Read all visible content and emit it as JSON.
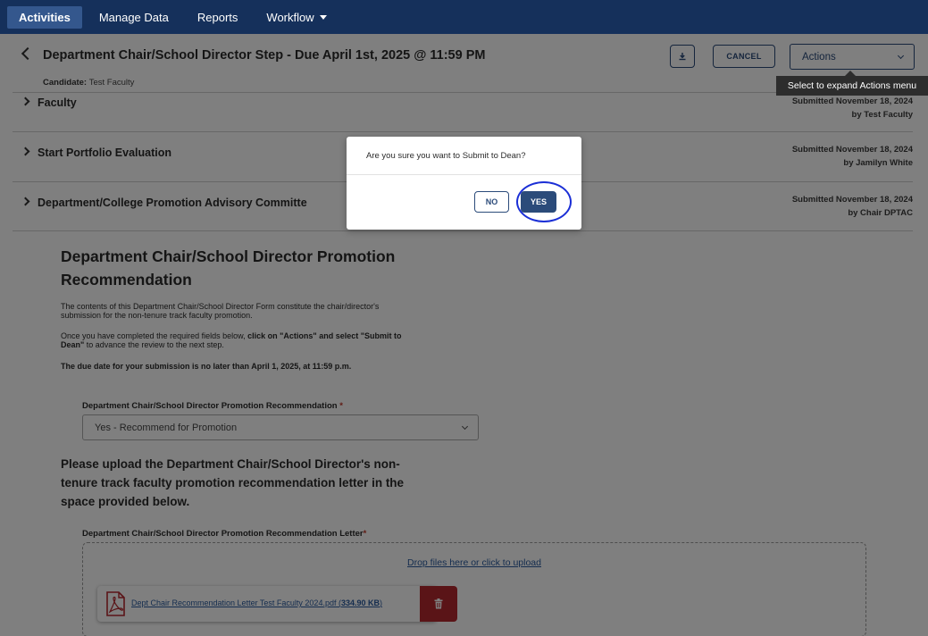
{
  "nav": {
    "items": [
      {
        "label": "Activities"
      },
      {
        "label": "Manage Data"
      },
      {
        "label": "Reports"
      },
      {
        "label": "Workflow"
      }
    ]
  },
  "header": {
    "title": "Department Chair/School Director Step - Due April 1st, 2025 @ 11:59 PM",
    "candidate_label": "Candidate:",
    "candidate_value": "Test Faculty",
    "cancel_label": "CANCEL",
    "actions_label": "Actions",
    "tooltip": "Select to expand Actions menu"
  },
  "sections": [
    {
      "title": "Faculty",
      "status_line1": "Submitted November 18, 2024",
      "status_line2": "by Test Faculty"
    },
    {
      "title": "Start Portfolio Evaluation",
      "status_line1": "Submitted November 18, 2024",
      "status_line2": "by Jamilyn White"
    },
    {
      "title": "Department/College Promotion Advisory Committe",
      "status_line1": "Submitted November 18, 2024",
      "status_line2": "by Chair DPTAC"
    }
  ],
  "form": {
    "heading": "Department Chair/School Director Promotion Recommendation",
    "para1": "The contents of this Department Chair/School Director Form constitute the chair/director's submission for the non-tenure track faculty promotion.",
    "para2_a": "Once you have completed the required fields below, ",
    "para2_b": "click on \"Actions\" and select \"Submit to Dean\"",
    "para2_c": " to advance the review to the next step.",
    "para3": "The due date for your submission is no later than April 1, 2025, at 11:59 p.m.",
    "recommendation_label": "Department Chair/School Director Promotion Recommendation",
    "recommendation_value": "Yes - Recommend for Promotion",
    "upload_heading": "Please upload the Department Chair/School Director's non-tenure track faculty promotion recommendation letter in the space provided below.",
    "letter_label": "Department Chair/School Director Promotion Recommendation Letter",
    "required_mark": "*",
    "drop_text": "Drop files here or click to upload",
    "file_name": "Dept Chair Recommendation Letter Test Faculty 2024.pdf",
    "file_size": "334.90 KB"
  },
  "modal": {
    "message": "Are you sure you want to Submit to Dean?",
    "no_label": "NO",
    "yes_label": "YES"
  },
  "colors": {
    "nav_bg": "#15305b",
    "primary": "#2b4b7a",
    "danger": "#b5282f",
    "highlight": "#1b2fd6"
  }
}
